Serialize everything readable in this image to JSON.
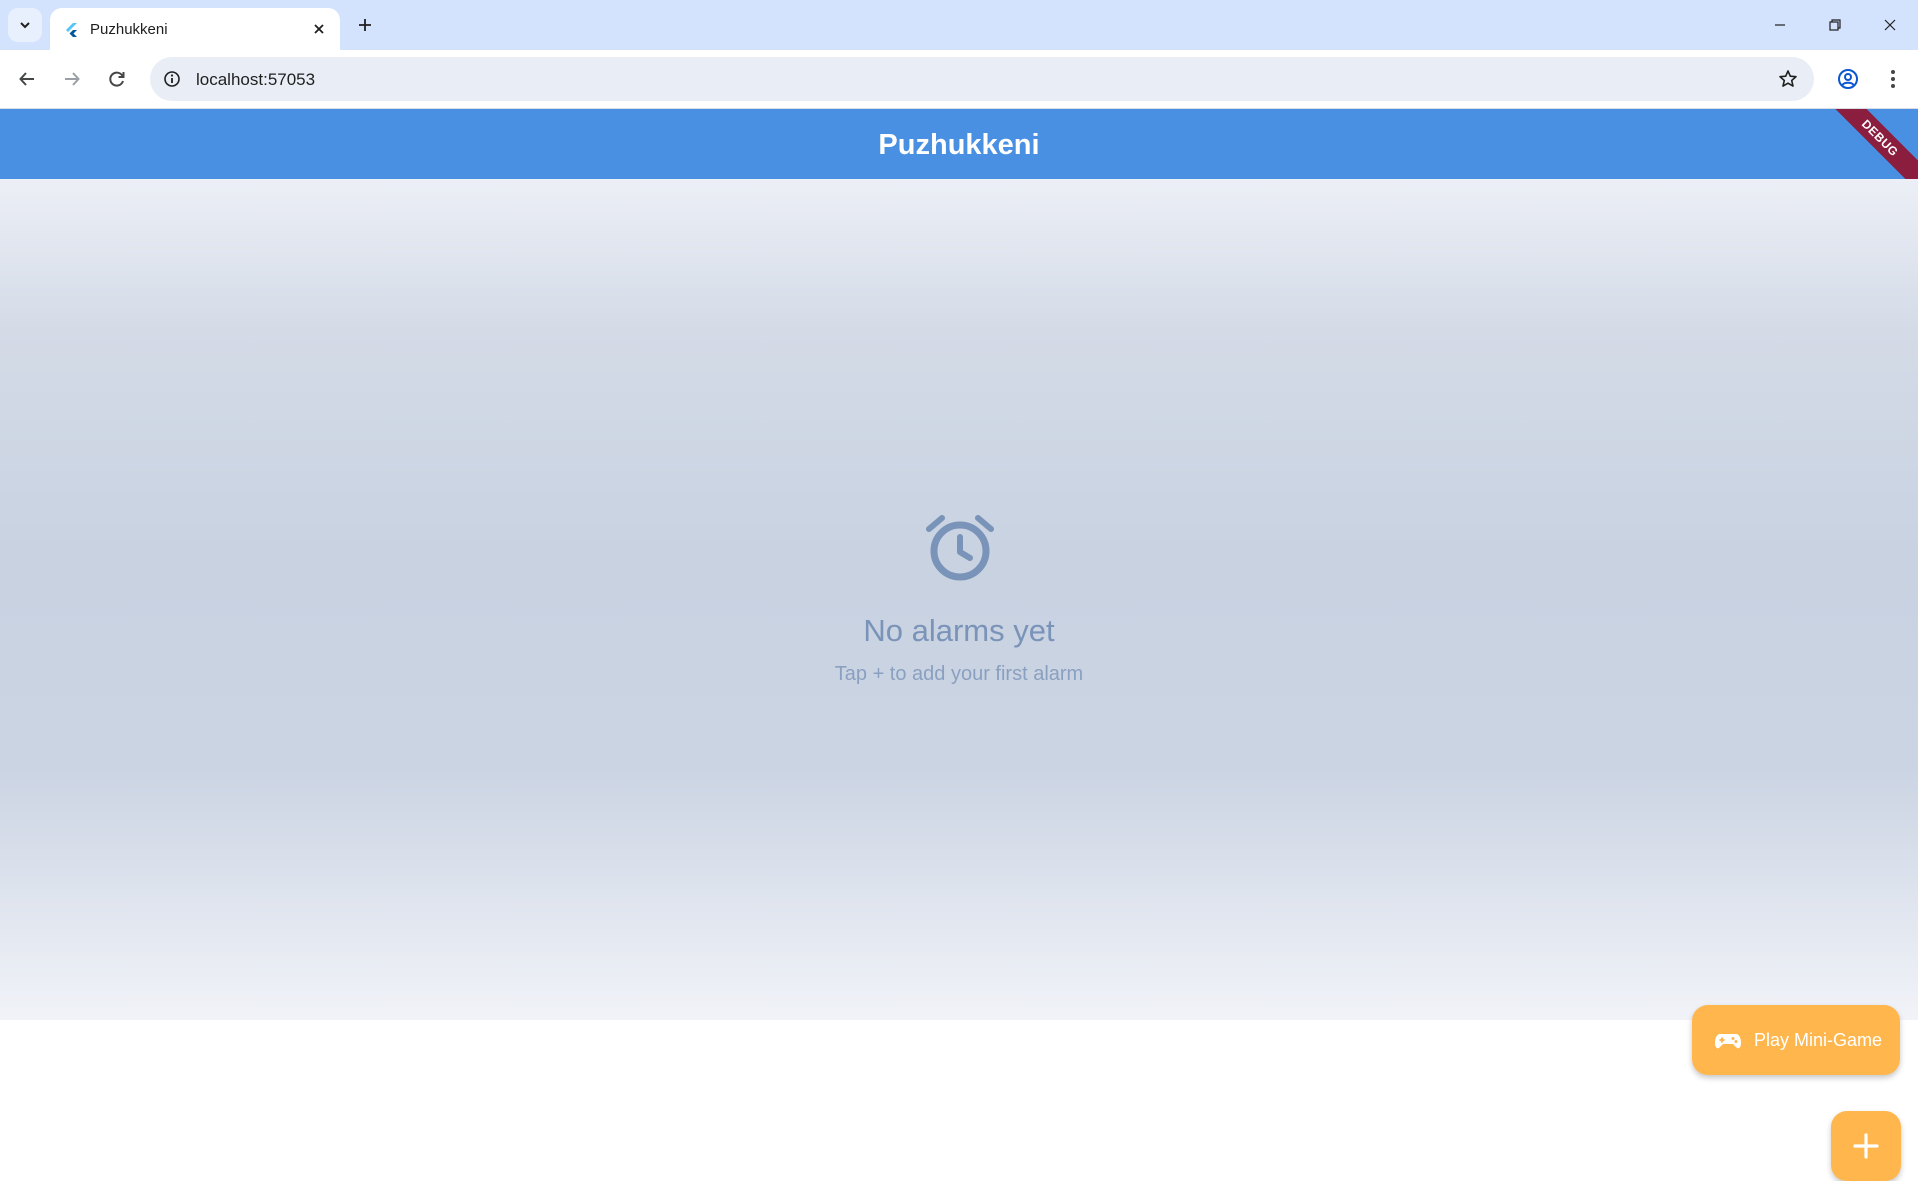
{
  "browser": {
    "tab_title": "Puzhukkeni",
    "url": "localhost:57053",
    "icons": {
      "tab_search": "chevron-down-icon",
      "favicon": "flutter-icon",
      "tab_close": "close-icon",
      "new_tab": "plus-icon",
      "back": "arrow-left-icon",
      "forward": "arrow-right-icon",
      "reload": "reload-icon",
      "site_info": "info-icon",
      "bookmark": "star-icon",
      "profile": "profile-icon",
      "menu": "more-vert-icon",
      "minimize": "minimize-icon",
      "restore": "restore-icon",
      "close_window": "close-icon"
    }
  },
  "app": {
    "title": "Puzhukkeni",
    "debug_banner": "DEBUG",
    "empty_state": {
      "icon": "alarm-clock-icon",
      "title": "No alarms yet",
      "subtitle": "Tap + to add your first alarm"
    },
    "minigame_button": {
      "icon": "gamepad-icon",
      "label": "Play Mini-Game"
    },
    "add_button": {
      "icon": "plus-icon"
    }
  },
  "colors": {
    "appbar": "#4a90e2",
    "accent_orange": "#ffb74d",
    "empty_text": "#7a93b8",
    "debug_banner": "#8b1e3f"
  }
}
